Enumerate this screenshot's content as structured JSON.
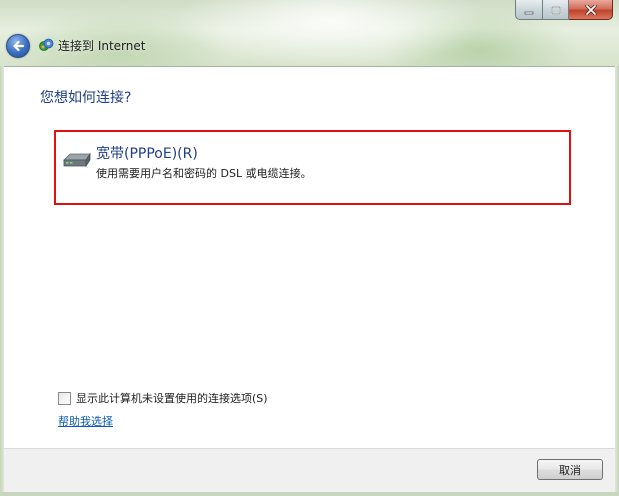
{
  "window": {
    "title": "连接到 Internet",
    "icons": {
      "back": "back-arrow-icon",
      "title": "network-globe-icon",
      "minimize": "minimize-icon",
      "maximize": "maximize-icon",
      "close": "close-icon"
    }
  },
  "main": {
    "heading": "您想如何连接?",
    "option": {
      "title": "宽带(PPPoE)(R)",
      "description": "使用需要用户名和密码的 DSL 或电缆连接。",
      "icon": "broadband-modem-icon"
    },
    "checkbox_label": "显示此计算机未设置使用的连接选项(S)",
    "checkbox_checked": false,
    "help_link": "帮助我选择"
  },
  "footer": {
    "cancel_label": "取消"
  },
  "colors": {
    "highlight_border": "#e01010",
    "heading": "#1f3f86",
    "link": "#0d5bb5"
  }
}
